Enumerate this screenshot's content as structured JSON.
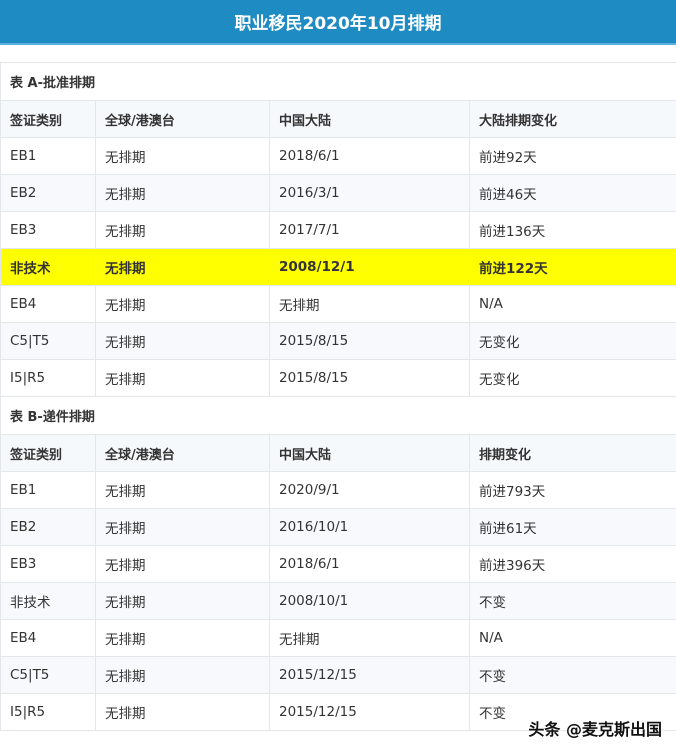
{
  "title": "职业移民2020年10月排期",
  "table_a": {
    "caption": "表 A-批准排期",
    "headers": [
      "签证类别",
      "全球/港澳台",
      "中国大陆",
      "大陆排期变化"
    ],
    "rows": [
      [
        "EB1",
        "无排期",
        "2018/6/1",
        "前进92天"
      ],
      [
        "EB2",
        "无排期",
        "2016/3/1",
        "前进46天"
      ],
      [
        "EB3",
        "无排期",
        "2017/7/1",
        "前进136天"
      ],
      [
        "非技术",
        "无排期",
        "2008/12/1",
        "前进122天"
      ],
      [
        "EB4",
        "无排期",
        "无排期",
        "N/A"
      ],
      [
        "C5|T5",
        "无排期",
        "2015/8/15",
        "无变化"
      ],
      [
        "I5|R5",
        "无排期",
        "2015/8/15",
        "无变化"
      ]
    ],
    "highlight_row": 3
  },
  "table_b": {
    "caption": "表 B-递件排期",
    "headers": [
      "签证类别",
      "全球/港澳台",
      "中国大陆",
      "排期变化"
    ],
    "rows": [
      [
        "EB1",
        "无排期",
        "2020/9/1",
        "前进793天"
      ],
      [
        "EB2",
        "无排期",
        "2016/10/1",
        "前进61天"
      ],
      [
        "EB3",
        "无排期",
        "2018/6/1",
        "前进396天"
      ],
      [
        "非技术",
        "无排期",
        "2008/10/1",
        "不变"
      ],
      [
        "EB4",
        "无排期",
        "无排期",
        "N/A"
      ],
      [
        "C5|T5",
        "无排期",
        "2015/12/15",
        "不变"
      ],
      [
        "I5|R5",
        "无排期",
        "2015/12/15",
        "不变"
      ]
    ]
  },
  "watermark": "头条 @麦克斯出国",
  "colors": {
    "title_bg": "#1e8bc3",
    "highlight": "#ffff00"
  }
}
